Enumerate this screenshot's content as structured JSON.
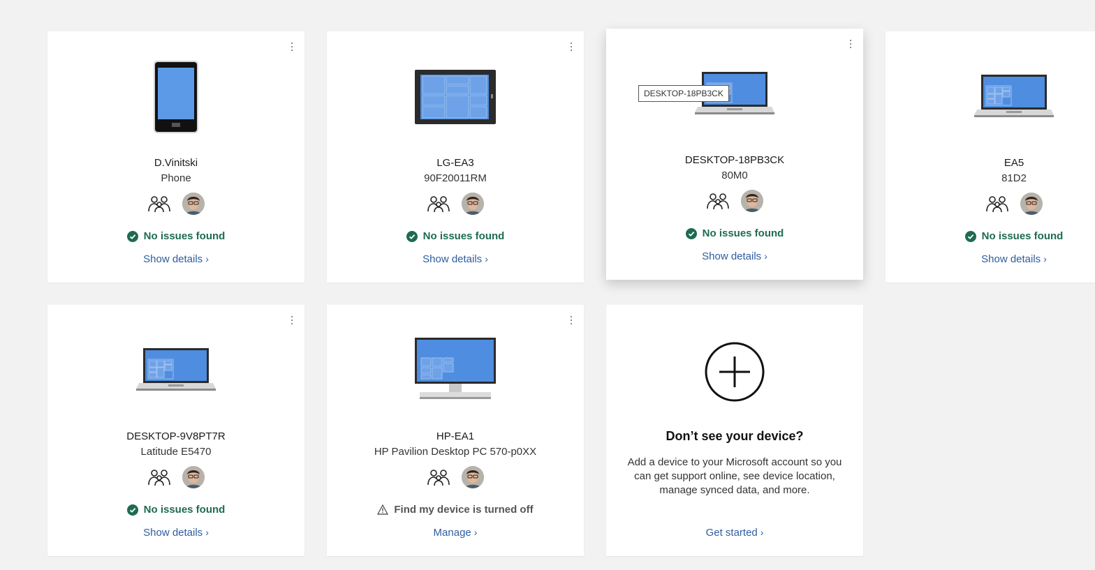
{
  "tooltip": "DESKTOP-18PB3CK",
  "devices": [
    {
      "name": "D.Vinitski",
      "model": "Phone",
      "status": "No issues found",
      "link": "Show details"
    },
    {
      "name": "LG-EA3",
      "model": "90F20011RM",
      "status": "No issues found",
      "link": "Show details"
    },
    {
      "name": "DESKTOP-18PB3CK",
      "model": "80M0",
      "status": "No issues found",
      "link": "Show details"
    },
    {
      "name": "EA5",
      "model": "81D2",
      "status": "No issues found",
      "link": "Show details"
    },
    {
      "name": "DESKTOP-9V8PT7R",
      "model": "Latitude E5470",
      "status": "No issues found",
      "link": "Show details"
    },
    {
      "name": "HP-EA1",
      "model": "HP Pavilion Desktop PC 570-p0XX",
      "status": "Find my device is turned off",
      "link": "Manage"
    }
  ],
  "add_device": {
    "title": "Don’t see your device?",
    "description": "Add a device to your Microsoft account so you can get support online, see device location, manage synced data, and more.",
    "link": "Get started"
  },
  "icons": {
    "more": "more-options-icon",
    "family": "family-group-icon",
    "check": "check-circle-icon",
    "warning": "warning-triangle-icon",
    "chevron": "chevron-right-icon",
    "plus": "plus-circle-icon"
  },
  "colors": {
    "status_ok": "#1e6b52",
    "link": "#2e5d9f",
    "screen": "#4f8de0"
  }
}
